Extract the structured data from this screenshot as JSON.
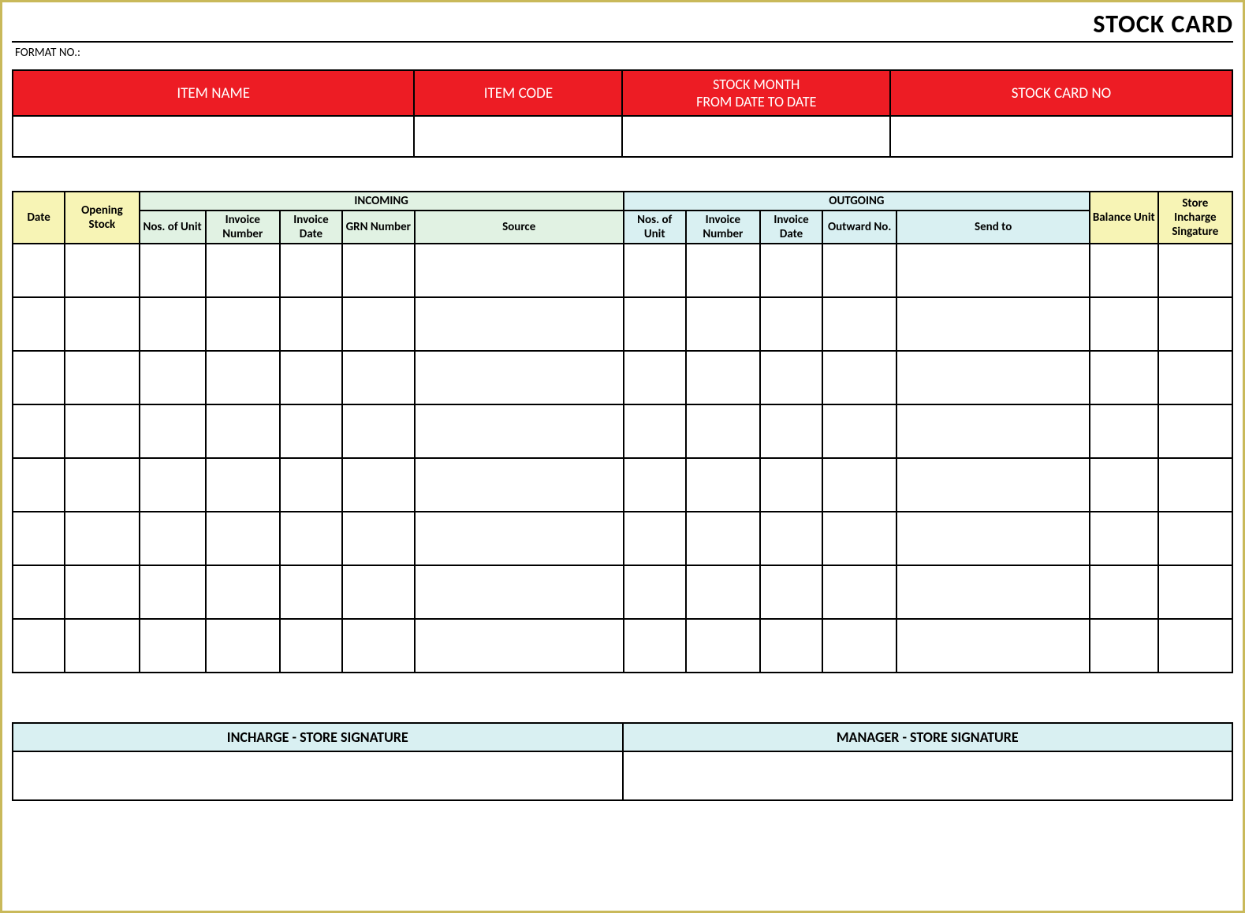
{
  "title": "STOCK CARD",
  "format_label": "FORMAT NO.:",
  "info": {
    "item_name": "ITEM NAME",
    "item_code": "ITEM CODE",
    "stock_month_line1": "STOCK MONTH",
    "stock_month_line2": "FROM DATE  TO DATE",
    "card_no": "STOCK CARD NO",
    "values": {
      "item_name": "",
      "item_code": "",
      "stock_month": "",
      "card_no": ""
    }
  },
  "table": {
    "headers": {
      "date": "Date",
      "opening": "Opening Stock",
      "incoming": "INCOMING",
      "outgoing": "OUTGOING",
      "balance": "Balance Unit",
      "store_sig": "Store Incharge Singature",
      "in_nos": "Nos. of Unit",
      "in_invn": "Invoice Number",
      "in_invd": "Invoice Date",
      "in_grn": "GRN Number",
      "in_src": "Source",
      "out_nos": "Nos. of Unit",
      "out_invn": "Invoice Number",
      "out_invd": "Invoice Date",
      "out_outn": "Outward No.",
      "out_send": "Send to"
    },
    "row_count": 8
  },
  "signatures": {
    "incharge": "INCHARGE - STORE SIGNATURE",
    "manager": "MANAGER - STORE SIGNATURE"
  }
}
